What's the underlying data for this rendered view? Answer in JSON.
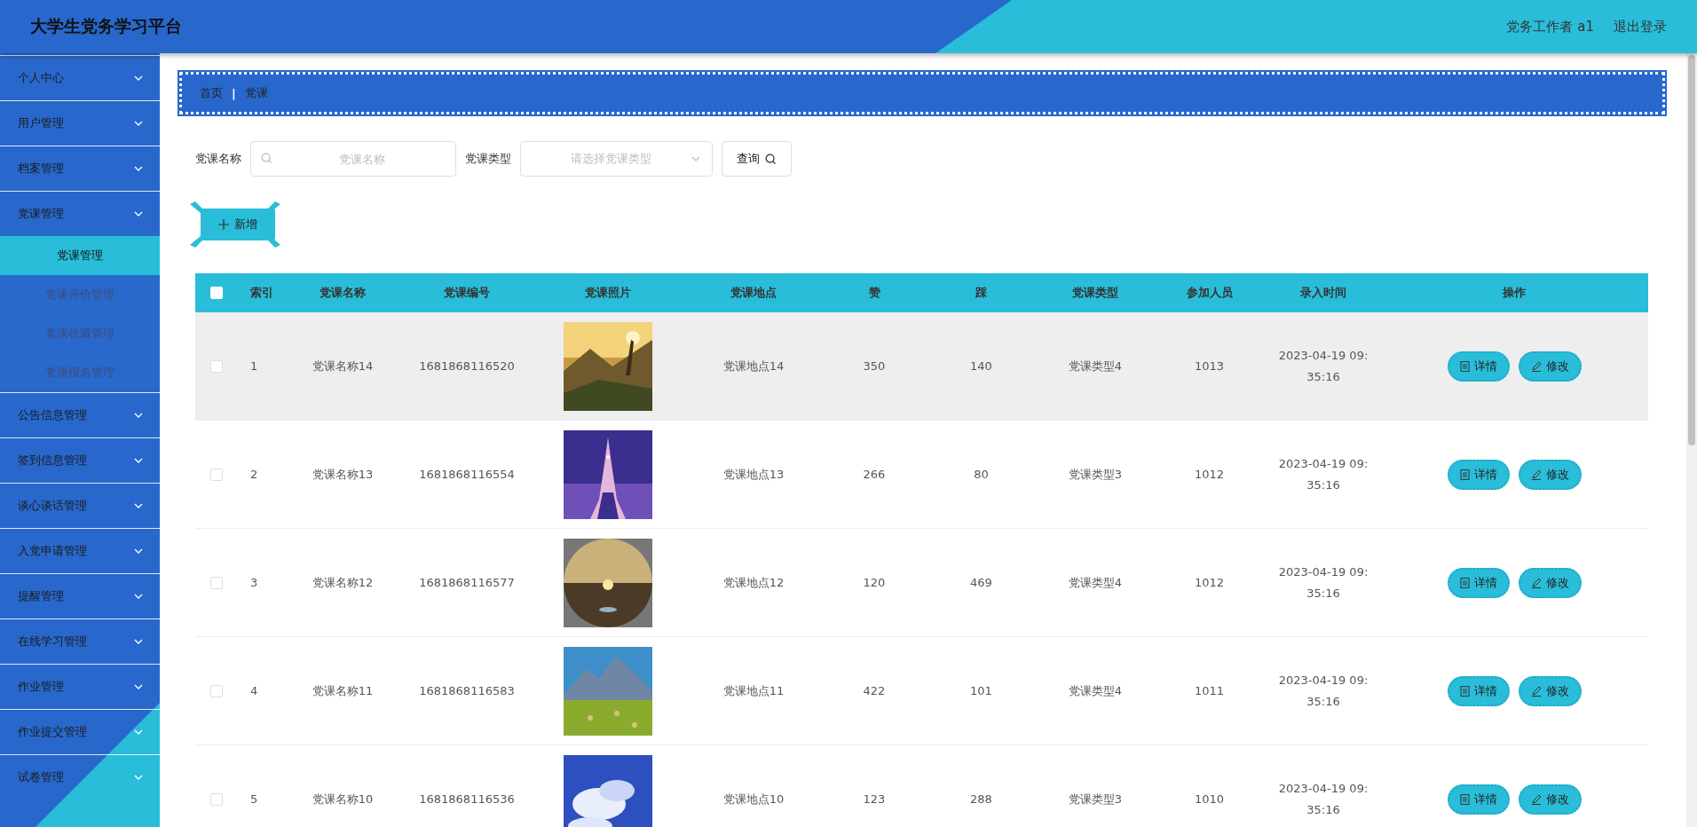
{
  "header": {
    "title": "大学生党务学习平台",
    "user": "党务工作者 a1",
    "logout": "退出登录"
  },
  "sidebar": {
    "items": [
      {
        "label": "个人中心"
      },
      {
        "label": "用户管理"
      },
      {
        "label": "档案管理"
      },
      {
        "label": "党课管理",
        "expanded": true,
        "children": [
          {
            "label": "党课管理",
            "selected": true
          },
          {
            "label": "党课评价管理",
            "selected": false
          },
          {
            "label": "党课收藏管理",
            "selected": false
          },
          {
            "label": "党课报名管理",
            "selected": false
          }
        ]
      },
      {
        "label": "公告信息管理"
      },
      {
        "label": "签到信息管理"
      },
      {
        "label": "谈心谈话管理"
      },
      {
        "label": "入党申请管理"
      },
      {
        "label": "提醒管理"
      },
      {
        "label": "在线学习管理"
      },
      {
        "label": "作业管理"
      },
      {
        "label": "作业提交管理"
      },
      {
        "label": "试卷管理"
      }
    ]
  },
  "breadcrumb": [
    "首页",
    "|",
    "党课"
  ],
  "search": {
    "name_label": "党课名称",
    "name_placeholder": "党课名称",
    "type_label": "党课类型",
    "type_placeholder": "请选择党课类型",
    "query_button": "查询"
  },
  "add_button": "新增",
  "table": {
    "header_checked": false,
    "columns": [
      "索引",
      "党课名称",
      "党课编号",
      "党课照片",
      "党课地点",
      "赞",
      "踩",
      "党课类型",
      "参加人员",
      "录入时间",
      "操作"
    ],
    "rows": [
      {
        "checked": false,
        "highlighted": true,
        "index": "1",
        "name": "党课名称14",
        "code": "1681868116520",
        "photo": {
          "kind": "picture"
        },
        "place": "党课地点14",
        "likes": "350",
        "dislikes": "140",
        "type": "党课类型4",
        "people": "1013",
        "time": "2023-04-19 09:35:16",
        "actions": [
          "详情",
          "修改"
        ]
      },
      {
        "checked": false,
        "highlighted": false,
        "index": "2",
        "name": "党课名称13",
        "code": "1681868116554",
        "photo": {
          "kind": "picture"
        },
        "place": "党课地点13",
        "likes": "266",
        "dislikes": "80",
        "type": "党课类型3",
        "people": "1012",
        "time": "2023-04-19 09:35:16",
        "actions": [
          "详情",
          "修改"
        ]
      },
      {
        "checked": false,
        "highlighted": false,
        "index": "3",
        "name": "党课名称12",
        "code": "1681868116577",
        "photo": {
          "kind": "picture"
        },
        "place": "党课地点12",
        "likes": "120",
        "dislikes": "469",
        "type": "党课类型4",
        "people": "1012",
        "time": "2023-04-19 09:35:16",
        "actions": [
          "详情",
          "修改"
        ]
      },
      {
        "checked": false,
        "highlighted": false,
        "index": "4",
        "name": "党课名称11",
        "code": "1681868116583",
        "photo": {
          "kind": "picture"
        },
        "place": "党课地点11",
        "likes": "422",
        "dislikes": "101",
        "type": "党课类型4",
        "people": "1011",
        "time": "2023-04-19 09:35:16",
        "actions": [
          "详情",
          "修改"
        ]
      },
      {
        "checked": false,
        "highlighted": false,
        "index": "5",
        "name": "党课名称10",
        "code": "1681868116536",
        "photo": {
          "kind": "picture"
        },
        "place": "党课地点10",
        "likes": "123",
        "dislikes": "288",
        "type": "党课类型3",
        "people": "1010",
        "time": "2023-04-19 09:35:16",
        "actions": [
          "详情",
          "修改"
        ]
      }
    ]
  }
}
